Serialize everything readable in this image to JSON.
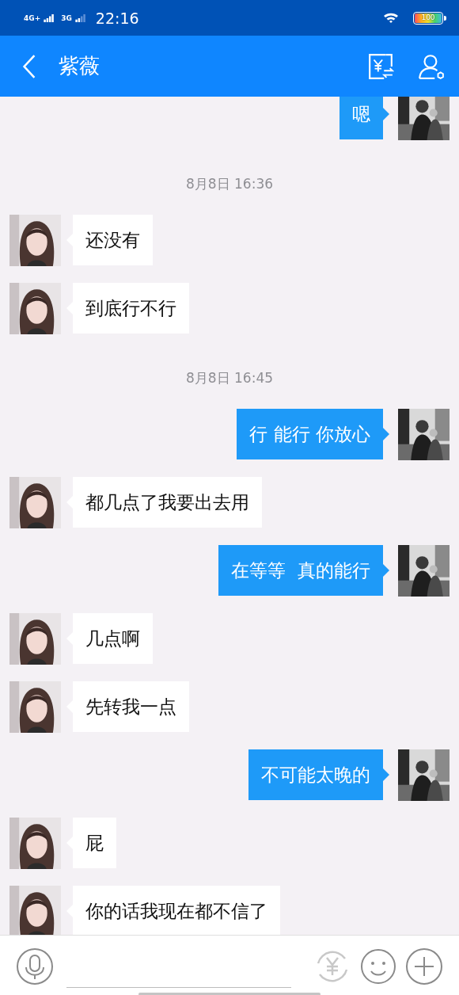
{
  "status_bar": {
    "network_1": "4G+",
    "network_2": "3G",
    "time": "22:16",
    "battery": "100"
  },
  "header": {
    "title": "紫薇"
  },
  "messages": [
    {
      "kind": "sent",
      "text": "嗯"
    },
    {
      "kind": "time",
      "text": "8月8日 16:36"
    },
    {
      "kind": "received",
      "text": "还没有"
    },
    {
      "kind": "received",
      "text": "到底行不行"
    },
    {
      "kind": "time",
      "text": "8月8日 16:45"
    },
    {
      "kind": "sent",
      "text": "行 能行 你放心"
    },
    {
      "kind": "received",
      "text": "都几点了我要出去用"
    },
    {
      "kind": "sent",
      "text": "在等等  真的能行"
    },
    {
      "kind": "received",
      "text": "几点啊"
    },
    {
      "kind": "received",
      "text": "先转我一点"
    },
    {
      "kind": "sent",
      "text": "不可能太晚的"
    },
    {
      "kind": "received",
      "text": "屁"
    },
    {
      "kind": "received",
      "text": "你的话我现在都不信了"
    }
  ]
}
